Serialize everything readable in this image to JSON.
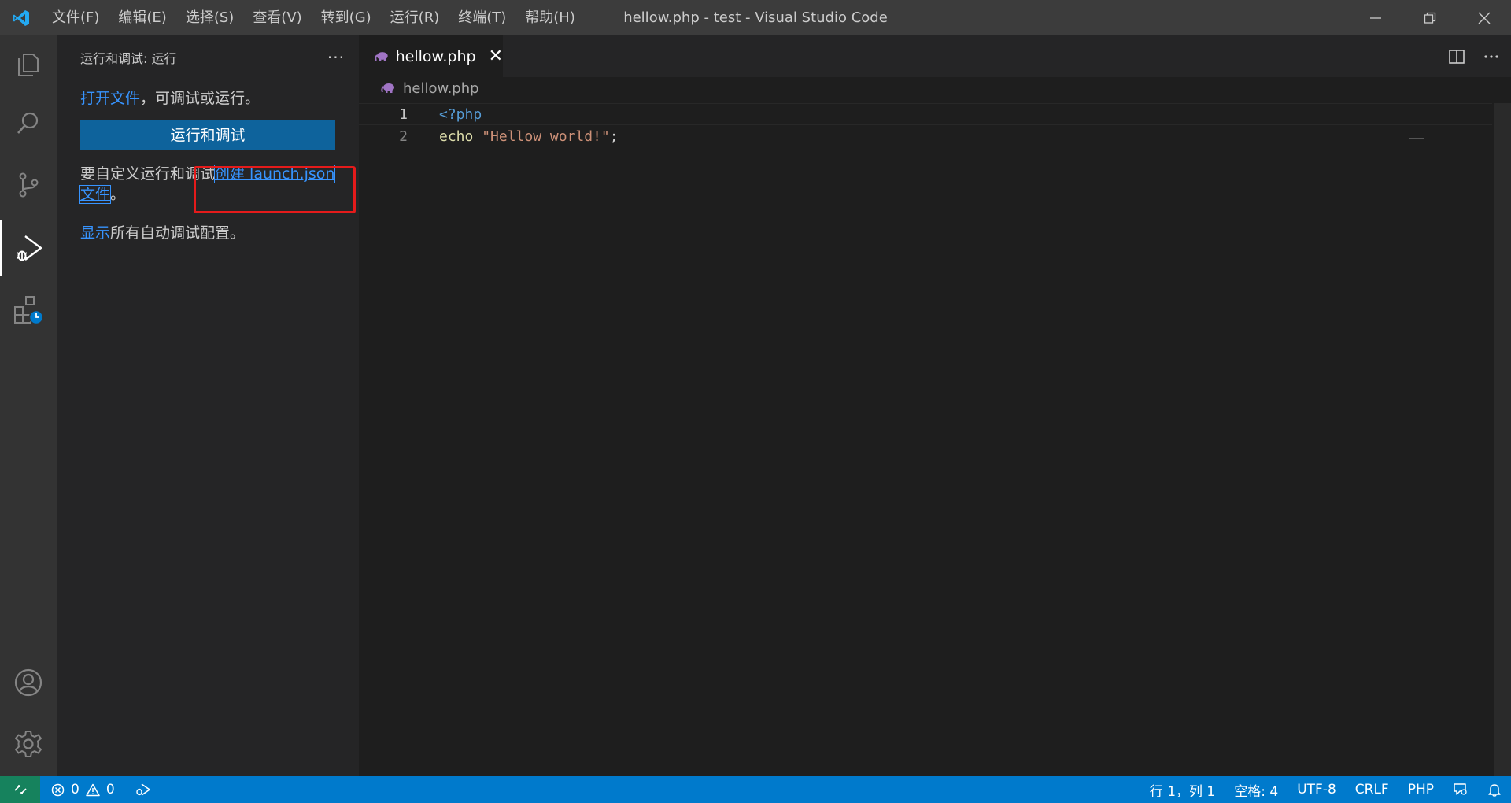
{
  "window": {
    "title": "hellow.php - test - Visual Studio Code",
    "menu": [
      "文件(F)",
      "编辑(E)",
      "选择(S)",
      "查看(V)",
      "转到(G)",
      "运行(R)",
      "终端(T)",
      "帮助(H)"
    ]
  },
  "activity_bar": {
    "items": [
      "files-icon",
      "search-icon",
      "source-control-icon",
      "run-debug-icon",
      "extensions-icon",
      "account-icon",
      "settings-gear-icon"
    ],
    "active": "run-debug-icon"
  },
  "sidebar": {
    "title": "运行和调试: 运行",
    "more": "···",
    "open_file_link": "打开文件",
    "open_file_rest": "，可调试或运行。",
    "run_button": "运行和调试",
    "customize_prefix": "要自定义运行和调试",
    "create_link": "创建 launch.json 文件",
    "customize_suffix": "。",
    "show_link": "显示",
    "show_rest": "所有自动调试配置。"
  },
  "editor": {
    "tab_label": "hellow.php",
    "tab_close": "✕",
    "breadcrumb": "hellow.php",
    "lines": [
      {
        "number": "1",
        "tokens": [
          {
            "text": "<?php",
            "kind": "kw"
          }
        ]
      },
      {
        "number": "2",
        "tokens": [
          {
            "text": "echo",
            "kind": "fn"
          },
          {
            "text": " ",
            "kind": "plain"
          },
          {
            "text": "\"Hellow world!\"",
            "kind": "str"
          },
          {
            "text": ";",
            "kind": "plain"
          }
        ]
      }
    ]
  },
  "statusbar": {
    "errors": "0",
    "warnings": "0",
    "cursor": "行 1，列 1",
    "indent": "空格: 4",
    "encoding": "UTF-8",
    "eol": "CRLF",
    "language": "PHP"
  },
  "colors": {
    "accent": "#007acc",
    "link": "#3794ff",
    "button": "#0e639c",
    "highlight_box": "#e51b1b"
  }
}
